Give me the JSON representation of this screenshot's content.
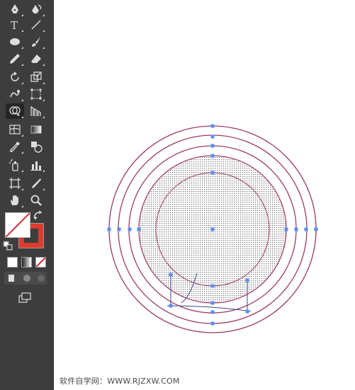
{
  "toolbar": {
    "tools": [
      {
        "name": "pen-tool-icon",
        "glyph": "pen"
      },
      {
        "name": "curvature-pen-icon",
        "glyph": "pen2"
      },
      {
        "name": "type-tool-icon",
        "glyph": "T"
      },
      {
        "name": "line-segment-tool-icon",
        "glyph": "line"
      },
      {
        "name": "ellipse-tool-icon",
        "glyph": "ellipse"
      },
      {
        "name": "paintbrush-tool-icon",
        "glyph": "brush"
      },
      {
        "name": "pencil-tool-icon",
        "glyph": "pencil"
      },
      {
        "name": "eraser-tool-icon",
        "glyph": "eraser"
      },
      {
        "name": "rotate-tool-icon",
        "glyph": "rotate"
      },
      {
        "name": "scale-tool-icon",
        "glyph": "scale"
      },
      {
        "name": "warp-tool-icon",
        "glyph": "warp"
      },
      {
        "name": "free-transform-tool-icon",
        "glyph": "freetransform"
      },
      {
        "name": "shape-builder-tool-icon",
        "glyph": "shapebuilder"
      },
      {
        "name": "perspective-grid-tool-icon",
        "glyph": "perspective"
      },
      {
        "name": "mesh-tool-icon",
        "glyph": "mesh"
      },
      {
        "name": "gradient-tool-icon",
        "glyph": "gradient"
      },
      {
        "name": "eyedropper-tool-icon",
        "glyph": "eyedropper"
      },
      {
        "name": "blend-tool-icon",
        "glyph": "blend"
      },
      {
        "name": "symbol-sprayer-tool-icon",
        "glyph": "sprayer"
      },
      {
        "name": "column-graph-tool-icon",
        "glyph": "graph"
      },
      {
        "name": "artboard-tool-icon",
        "glyph": "artboard"
      },
      {
        "name": "slice-tool-icon",
        "glyph": "slice"
      },
      {
        "name": "hand-tool-icon",
        "glyph": "hand"
      },
      {
        "name": "zoom-tool-icon",
        "glyph": "zoom"
      }
    ],
    "active_tool": "shape-builder-tool-icon",
    "fill_color": "#ffffff",
    "stroke_color": "#e03a2f"
  },
  "canvas": {
    "background": "#ffffff",
    "circle_stroke": "#9c3a6a",
    "anchor_color": "#5b8ef0",
    "hatch_color": "#6a6a6a"
  },
  "watermark": "软件自学网：WWW.RJZXW.COM"
}
